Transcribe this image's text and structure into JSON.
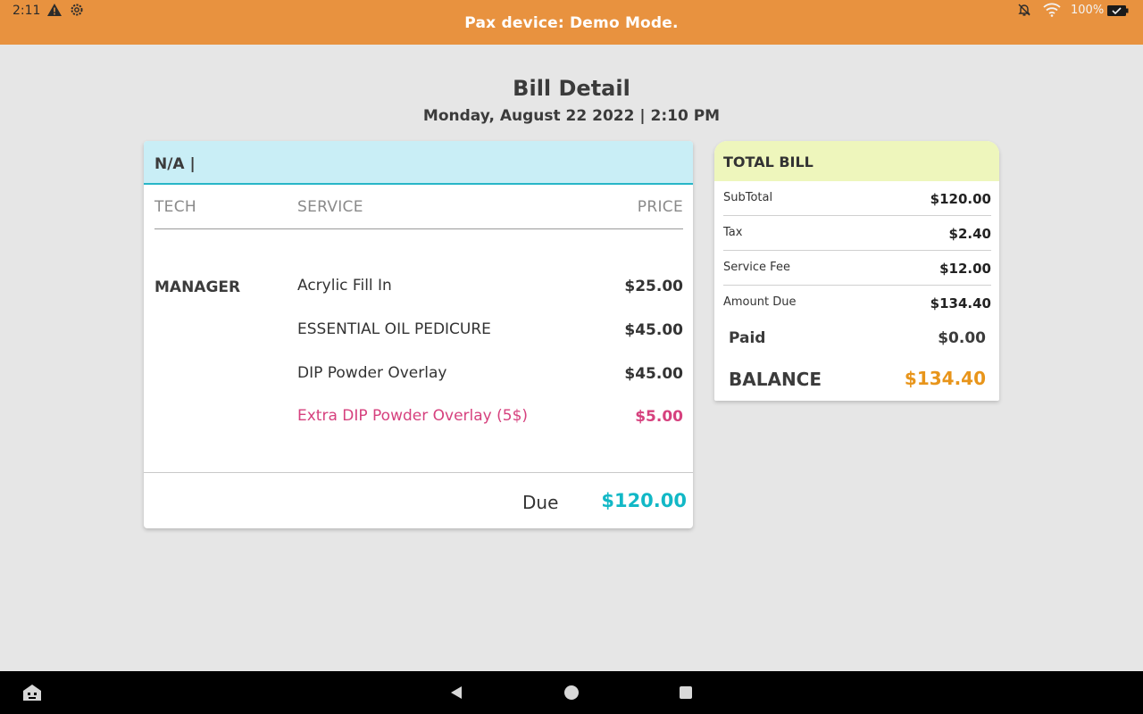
{
  "status_bar": {
    "time": "2:11",
    "battery_text": "100%"
  },
  "header": {
    "title": "Pax device: Demo Mode.",
    "color": "#e8923f"
  },
  "page": {
    "title": "Bill Detail",
    "date": "Monday, August 22 2022 | 2:10 PM"
  },
  "bill": {
    "customer": "N/A |",
    "columns": {
      "tech": "TECH",
      "service": "SERVICE",
      "price": "PRICE"
    },
    "tech": "MANAGER",
    "items": [
      {
        "service": "Acrylic Fill In",
        "price": "$25.00",
        "extra": false
      },
      {
        "service": "ESSENTIAL OIL PEDICURE",
        "price": "$45.00",
        "extra": false
      },
      {
        "service": "DIP Powder Overlay",
        "price": "$45.00",
        "extra": false
      },
      {
        "service": "Extra DIP Powder Overlay (5$)",
        "price": "$5.00",
        "extra": true
      }
    ],
    "due_label": "Due",
    "due_amount": "$120.00"
  },
  "total": {
    "header": "TOTAL BILL",
    "rows": [
      {
        "label": "SubTotal",
        "value": "$120.00"
      },
      {
        "label": "Tax",
        "value": "$2.40"
      },
      {
        "label": "Service Fee",
        "value": "$12.00"
      },
      {
        "label": "Amount Due",
        "value": "$134.40"
      }
    ],
    "paid_label": "Paid",
    "paid_value": "$0.00",
    "balance_label": "BALANCE",
    "balance_value": "$134.40"
  },
  "colors": {
    "accent_teal": "#12b8c6",
    "extra_pink": "#d6417e",
    "balance_orange": "#e8951b"
  },
  "icons": {
    "status": [
      "warning-icon",
      "settings-gear-icon",
      "notifications-off-icon",
      "wifi-icon",
      "battery-icon"
    ],
    "nav": [
      "keyboard-switch-icon",
      "back-icon",
      "home-icon",
      "recent-apps-icon"
    ]
  }
}
